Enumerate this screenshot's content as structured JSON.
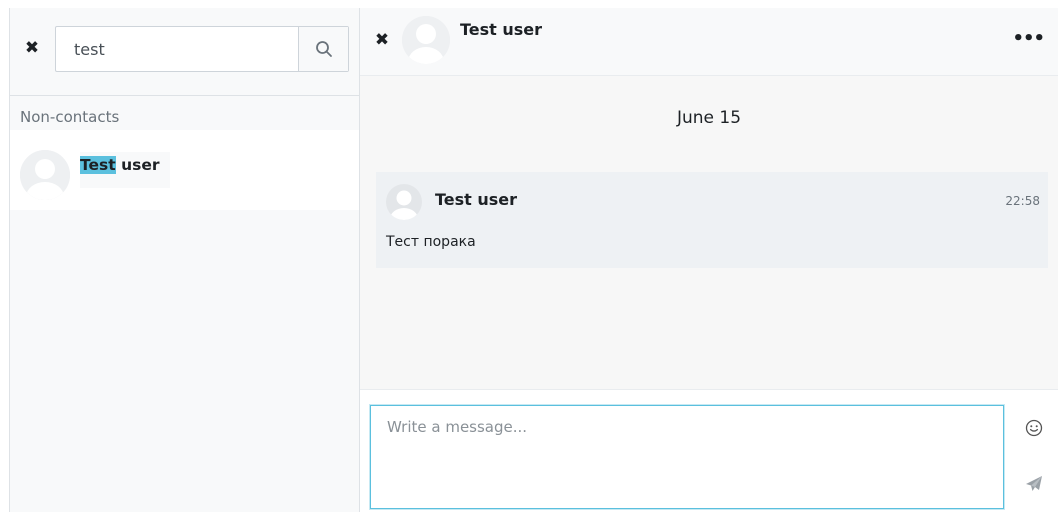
{
  "search_panel": {
    "close_label": "✖",
    "search_value": "test",
    "search_icon": "search-icon",
    "section_label": "Non-contacts",
    "results": [
      {
        "name_highlight": "Test",
        "name_rest": " user",
        "avatar_icon": "default-user-avatar"
      }
    ]
  },
  "conversation": {
    "close_label": "✖",
    "header_name": "Test user",
    "menu_label": "•••",
    "header_avatar_icon": "default-user-avatar",
    "date_label": "June 15",
    "messages": [
      {
        "sender": "Test user",
        "time": "22:58",
        "text": "Тест порака",
        "avatar_icon": "default-user-avatar"
      }
    ],
    "compose": {
      "placeholder": "Write a message...",
      "emoji_icon": "smiley-icon",
      "send_icon": "paper-plane-icon"
    }
  },
  "colors": {
    "highlight": "#5bc0de",
    "input_focus_border": "#5bc0de",
    "panel_bg": "#f8f9fa",
    "message_bg": "#eef1f4"
  }
}
